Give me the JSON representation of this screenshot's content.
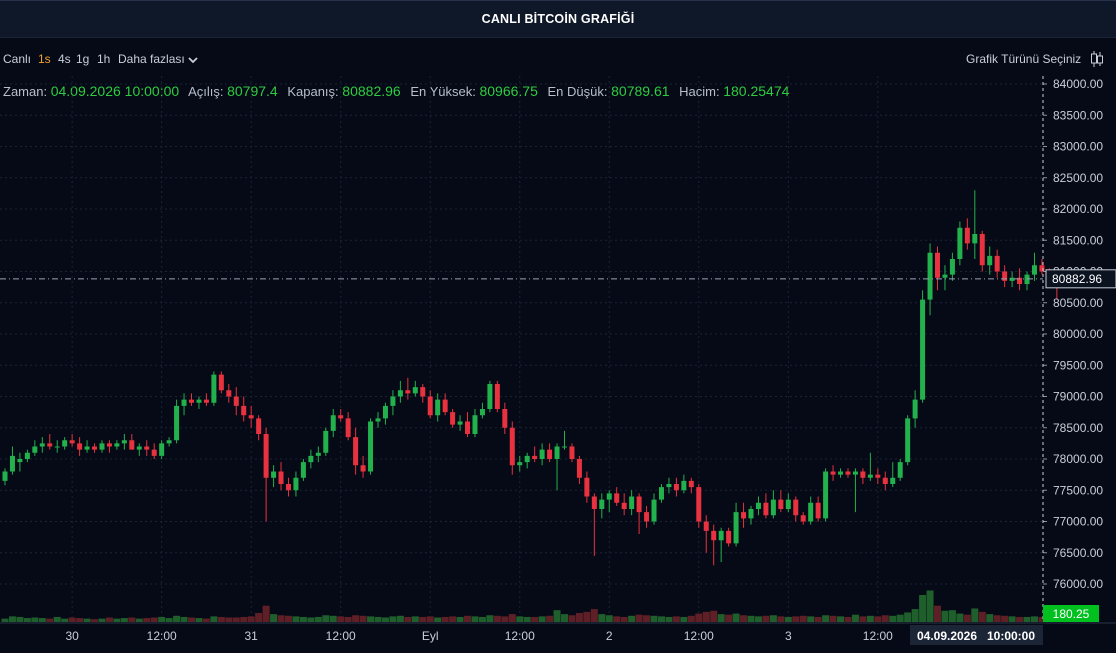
{
  "title": "CANLI BİTCOİN GRAFİĞİ",
  "toolbar": {
    "live": "Canlı",
    "intervals": [
      "1s",
      "4s",
      "1g",
      "1h"
    ],
    "active_interval": "1s",
    "more": "Daha fazlası",
    "chart_type": "Grafik Türünü Seçiniz"
  },
  "ohlc": {
    "time_label": "Zaman:",
    "time": "04.09.2026 10:00:00",
    "open_label": "Açılış:",
    "open": "80797.4",
    "close_label": "Kapanış:",
    "close": "80882.96",
    "high_label": "En Yüksek:",
    "high": "80966.75",
    "low_label": "En Düşük:",
    "low": "80789.61",
    "volume_label": "Hacim:",
    "volume": "180.25474"
  },
  "price_tag": "80882.96",
  "volume_tag": "180.25",
  "crosshair_date": "04.09.2026",
  "crosshair_time": "10:00:00",
  "colors": {
    "up": "#22b14c",
    "down": "#e8323f",
    "background": "#050a16",
    "grid": "#1a2433",
    "volume_tag": "#00c020"
  },
  "chart_data": {
    "type": "candlestick",
    "title": "CANLI BİTCOİN GRAFİĞİ",
    "xlabel": "",
    "ylabel": "",
    "ylim": [
      75850,
      84050
    ],
    "y_ticks": [
      76000,
      76500,
      77000,
      77500,
      78000,
      78500,
      79000,
      79500,
      80000,
      80500,
      81000,
      81500,
      82000,
      82500,
      83000,
      83500,
      84000
    ],
    "y_tick_labels": [
      "76000.00",
      "76500.00",
      "77000.00",
      "77500.00",
      "78000.00",
      "78500.00",
      "79000.00",
      "79500.00",
      "80000.00",
      "80500.00",
      "81000.00",
      "81500.00",
      "82000.00",
      "82500.00",
      "83000.00",
      "83500.00",
      "84000.00"
    ],
    "x_ticks": [
      {
        "label": "30",
        "index": 9
      },
      {
        "label": "12:00",
        "index": 21
      },
      {
        "label": "31",
        "index": 33
      },
      {
        "label": "12:00",
        "index": 45
      },
      {
        "label": "Eyl",
        "index": 57
      },
      {
        "label": "12:00",
        "index": 69
      },
      {
        "label": "2",
        "index": 81
      },
      {
        "label": "12:00",
        "index": 93
      },
      {
        "label": "3",
        "index": 105
      },
      {
        "label": "12:00",
        "index": 117
      }
    ],
    "grid": true,
    "candles": [
      {
        "o": 77650,
        "h": 77850,
        "l": 77580,
        "c": 77800,
        "v": 6
      },
      {
        "o": 77800,
        "h": 78200,
        "l": 77750,
        "c": 78050,
        "v": 10
      },
      {
        "o": 77950,
        "h": 78100,
        "l": 77800,
        "c": 78000,
        "v": 9
      },
      {
        "o": 78000,
        "h": 78150,
        "l": 77950,
        "c": 78100,
        "v": 7
      },
      {
        "o": 78100,
        "h": 78300,
        "l": 78050,
        "c": 78200,
        "v": 8
      },
      {
        "o": 78200,
        "h": 78350,
        "l": 78100,
        "c": 78250,
        "v": 7
      },
      {
        "o": 78250,
        "h": 78400,
        "l": 78150,
        "c": 78200,
        "v": 6
      },
      {
        "o": 78200,
        "h": 78300,
        "l": 78100,
        "c": 78200,
        "v": 9
      },
      {
        "o": 78200,
        "h": 78350,
        "l": 78150,
        "c": 78300,
        "v": 6
      },
      {
        "o": 78300,
        "h": 78400,
        "l": 78200,
        "c": 78250,
        "v": 8
      },
      {
        "o": 78250,
        "h": 78350,
        "l": 78050,
        "c": 78150,
        "v": 7
      },
      {
        "o": 78150,
        "h": 78300,
        "l": 78100,
        "c": 78200,
        "v": 6
      },
      {
        "o": 78200,
        "h": 78250,
        "l": 78100,
        "c": 78150,
        "v": 5
      },
      {
        "o": 78150,
        "h": 78300,
        "l": 78100,
        "c": 78250,
        "v": 6
      },
      {
        "o": 78250,
        "h": 78300,
        "l": 78100,
        "c": 78200,
        "v": 8
      },
      {
        "o": 78200,
        "h": 78300,
        "l": 78150,
        "c": 78250,
        "v": 6
      },
      {
        "o": 78250,
        "h": 78400,
        "l": 78150,
        "c": 78300,
        "v": 7
      },
      {
        "o": 78300,
        "h": 78400,
        "l": 78150,
        "c": 78150,
        "v": 8
      },
      {
        "o": 78150,
        "h": 78250,
        "l": 78050,
        "c": 78200,
        "v": 6
      },
      {
        "o": 78200,
        "h": 78300,
        "l": 78050,
        "c": 78150,
        "v": 7
      },
      {
        "o": 78150,
        "h": 78250,
        "l": 78000,
        "c": 78050,
        "v": 8
      },
      {
        "o": 78050,
        "h": 78300,
        "l": 78000,
        "c": 78250,
        "v": 9
      },
      {
        "o": 78250,
        "h": 78350,
        "l": 78200,
        "c": 78300,
        "v": 7
      },
      {
        "o": 78300,
        "h": 78950,
        "l": 78250,
        "c": 78850,
        "v": 11
      },
      {
        "o": 78850,
        "h": 79050,
        "l": 78700,
        "c": 78950,
        "v": 9
      },
      {
        "o": 78950,
        "h": 79050,
        "l": 78850,
        "c": 78900,
        "v": 8
      },
      {
        "o": 78900,
        "h": 79000,
        "l": 78800,
        "c": 78950,
        "v": 7
      },
      {
        "o": 78950,
        "h": 79050,
        "l": 78850,
        "c": 78900,
        "v": 6
      },
      {
        "o": 78900,
        "h": 79400,
        "l": 78850,
        "c": 79350,
        "v": 10
      },
      {
        "o": 79350,
        "h": 79400,
        "l": 79050,
        "c": 79100,
        "v": 9
      },
      {
        "o": 79100,
        "h": 79200,
        "l": 78900,
        "c": 79000,
        "v": 8
      },
      {
        "o": 79000,
        "h": 79150,
        "l": 78700,
        "c": 78850,
        "v": 8
      },
      {
        "o": 78850,
        "h": 79000,
        "l": 78600,
        "c": 78700,
        "v": 9
      },
      {
        "o": 78700,
        "h": 78850,
        "l": 78500,
        "c": 78650,
        "v": 10
      },
      {
        "o": 78650,
        "h": 78700,
        "l": 78300,
        "c": 78400,
        "v": 16
      },
      {
        "o": 78400,
        "h": 78500,
        "l": 77000,
        "c": 77700,
        "v": 29
      },
      {
        "o": 77700,
        "h": 77900,
        "l": 77550,
        "c": 77800,
        "v": 14
      },
      {
        "o": 77800,
        "h": 77950,
        "l": 77500,
        "c": 77600,
        "v": 12
      },
      {
        "o": 77600,
        "h": 77700,
        "l": 77400,
        "c": 77500,
        "v": 11
      },
      {
        "o": 77500,
        "h": 77800,
        "l": 77400,
        "c": 77700,
        "v": 10
      },
      {
        "o": 77700,
        "h": 78000,
        "l": 77650,
        "c": 77950,
        "v": 9
      },
      {
        "o": 77950,
        "h": 78150,
        "l": 77850,
        "c": 78050,
        "v": 8
      },
      {
        "o": 78050,
        "h": 78200,
        "l": 77950,
        "c": 78100,
        "v": 9
      },
      {
        "o": 78100,
        "h": 78500,
        "l": 78050,
        "c": 78450,
        "v": 12
      },
      {
        "o": 78450,
        "h": 78800,
        "l": 78350,
        "c": 78700,
        "v": 11
      },
      {
        "o": 78700,
        "h": 78800,
        "l": 78600,
        "c": 78650,
        "v": 10
      },
      {
        "o": 78650,
        "h": 78750,
        "l": 78300,
        "c": 78350,
        "v": 9
      },
      {
        "o": 78350,
        "h": 78500,
        "l": 77750,
        "c": 77900,
        "v": 12
      },
      {
        "o": 77900,
        "h": 78050,
        "l": 77700,
        "c": 77800,
        "v": 11
      },
      {
        "o": 77800,
        "h": 78650,
        "l": 77750,
        "c": 78600,
        "v": 10
      },
      {
        "o": 78600,
        "h": 78750,
        "l": 78500,
        "c": 78650,
        "v": 9
      },
      {
        "o": 78650,
        "h": 78900,
        "l": 78550,
        "c": 78850,
        "v": 8
      },
      {
        "o": 78850,
        "h": 79100,
        "l": 78700,
        "c": 79000,
        "v": 10
      },
      {
        "o": 79000,
        "h": 79250,
        "l": 78900,
        "c": 79100,
        "v": 11
      },
      {
        "o": 79100,
        "h": 79300,
        "l": 78950,
        "c": 79050,
        "v": 9
      },
      {
        "o": 79050,
        "h": 79250,
        "l": 79000,
        "c": 79150,
        "v": 10
      },
      {
        "o": 79150,
        "h": 79200,
        "l": 78900,
        "c": 79000,
        "v": 9
      },
      {
        "o": 79000,
        "h": 79100,
        "l": 78650,
        "c": 78700,
        "v": 10
      },
      {
        "o": 78700,
        "h": 79050,
        "l": 78600,
        "c": 78950,
        "v": 8
      },
      {
        "o": 78950,
        "h": 79050,
        "l": 78700,
        "c": 78750,
        "v": 9
      },
      {
        "o": 78750,
        "h": 78800,
        "l": 78500,
        "c": 78550,
        "v": 10
      },
      {
        "o": 78550,
        "h": 78700,
        "l": 78450,
        "c": 78600,
        "v": 9
      },
      {
        "o": 78600,
        "h": 78750,
        "l": 78350,
        "c": 78400,
        "v": 11
      },
      {
        "o": 78400,
        "h": 78800,
        "l": 78350,
        "c": 78700,
        "v": 10
      },
      {
        "o": 78700,
        "h": 78900,
        "l": 78650,
        "c": 78800,
        "v": 9
      },
      {
        "o": 78800,
        "h": 79250,
        "l": 78750,
        "c": 79200,
        "v": 12
      },
      {
        "o": 79200,
        "h": 79250,
        "l": 78750,
        "c": 78800,
        "v": 11
      },
      {
        "o": 78800,
        "h": 78900,
        "l": 78400,
        "c": 78500,
        "v": 10
      },
      {
        "o": 78500,
        "h": 78600,
        "l": 77750,
        "c": 77900,
        "v": 14
      },
      {
        "o": 77900,
        "h": 78050,
        "l": 77800,
        "c": 77950,
        "v": 10
      },
      {
        "o": 77950,
        "h": 78100,
        "l": 77850,
        "c": 78050,
        "v": 9
      },
      {
        "o": 78050,
        "h": 78200,
        "l": 77950,
        "c": 78000,
        "v": 9
      },
      {
        "o": 78000,
        "h": 78250,
        "l": 77900,
        "c": 78150,
        "v": 10
      },
      {
        "o": 78150,
        "h": 78250,
        "l": 77950,
        "c": 78000,
        "v": 11
      },
      {
        "o": 78000,
        "h": 78250,
        "l": 77500,
        "c": 78200,
        "v": 21
      },
      {
        "o": 78200,
        "h": 78450,
        "l": 78150,
        "c": 78200,
        "v": 14
      },
      {
        "o": 78200,
        "h": 78250,
        "l": 77950,
        "c": 78000,
        "v": 12
      },
      {
        "o": 78000,
        "h": 78050,
        "l": 77600,
        "c": 77700,
        "v": 16
      },
      {
        "o": 77700,
        "h": 77800,
        "l": 77300,
        "c": 77400,
        "v": 18
      },
      {
        "o": 77400,
        "h": 77450,
        "l": 76450,
        "c": 77200,
        "v": 23
      },
      {
        "o": 77200,
        "h": 77450,
        "l": 77050,
        "c": 77350,
        "v": 14
      },
      {
        "o": 77350,
        "h": 77500,
        "l": 77150,
        "c": 77450,
        "v": 12
      },
      {
        "o": 77450,
        "h": 77550,
        "l": 77250,
        "c": 77300,
        "v": 10
      },
      {
        "o": 77300,
        "h": 77450,
        "l": 77100,
        "c": 77200,
        "v": 9
      },
      {
        "o": 77200,
        "h": 77500,
        "l": 77100,
        "c": 77400,
        "v": 11
      },
      {
        "o": 77400,
        "h": 77450,
        "l": 76800,
        "c": 77150,
        "v": 13
      },
      {
        "o": 77150,
        "h": 77250,
        "l": 76900,
        "c": 77000,
        "v": 12
      },
      {
        "o": 77000,
        "h": 77450,
        "l": 76950,
        "c": 77350,
        "v": 11
      },
      {
        "o": 77350,
        "h": 77600,
        "l": 77300,
        "c": 77550,
        "v": 10
      },
      {
        "o": 77550,
        "h": 77700,
        "l": 77450,
        "c": 77600,
        "v": 9
      },
      {
        "o": 77600,
        "h": 77700,
        "l": 77400,
        "c": 77500,
        "v": 10
      },
      {
        "o": 77500,
        "h": 77750,
        "l": 77450,
        "c": 77650,
        "v": 9
      },
      {
        "o": 77650,
        "h": 77700,
        "l": 77450,
        "c": 77550,
        "v": 11
      },
      {
        "o": 77550,
        "h": 77600,
        "l": 76900,
        "c": 77000,
        "v": 15
      },
      {
        "o": 77000,
        "h": 77100,
        "l": 76500,
        "c": 76850,
        "v": 18
      },
      {
        "o": 76850,
        "h": 76950,
        "l": 76300,
        "c": 76700,
        "v": 20
      },
      {
        "o": 76700,
        "h": 76900,
        "l": 76350,
        "c": 76850,
        "v": 14
      },
      {
        "o": 76850,
        "h": 76900,
        "l": 76600,
        "c": 76650,
        "v": 13
      },
      {
        "o": 76650,
        "h": 77300,
        "l": 76600,
        "c": 77150,
        "v": 15
      },
      {
        "o": 77150,
        "h": 77300,
        "l": 76900,
        "c": 77050,
        "v": 12
      },
      {
        "o": 77050,
        "h": 77250,
        "l": 76950,
        "c": 77200,
        "v": 11
      },
      {
        "o": 77200,
        "h": 77400,
        "l": 77100,
        "c": 77300,
        "v": 10
      },
      {
        "o": 77300,
        "h": 77450,
        "l": 77050,
        "c": 77100,
        "v": 11
      },
      {
        "o": 77100,
        "h": 77500,
        "l": 77050,
        "c": 77350,
        "v": 12
      },
      {
        "o": 77350,
        "h": 77500,
        "l": 77150,
        "c": 77200,
        "v": 10
      },
      {
        "o": 77200,
        "h": 77450,
        "l": 77150,
        "c": 77350,
        "v": 9
      },
      {
        "o": 77350,
        "h": 77400,
        "l": 77000,
        "c": 77100,
        "v": 10
      },
      {
        "o": 77100,
        "h": 77150,
        "l": 76950,
        "c": 77000,
        "v": 11
      },
      {
        "o": 77000,
        "h": 77400,
        "l": 76950,
        "c": 77300,
        "v": 10
      },
      {
        "o": 77300,
        "h": 77400,
        "l": 77000,
        "c": 77050,
        "v": 9
      },
      {
        "o": 77050,
        "h": 77850,
        "l": 77000,
        "c": 77800,
        "v": 12
      },
      {
        "o": 77800,
        "h": 77900,
        "l": 77650,
        "c": 77750,
        "v": 11
      },
      {
        "o": 77750,
        "h": 77850,
        "l": 77700,
        "c": 77800,
        "v": 10
      },
      {
        "o": 77800,
        "h": 77850,
        "l": 77700,
        "c": 77750,
        "v": 9
      },
      {
        "o": 77750,
        "h": 77850,
        "l": 77150,
        "c": 77800,
        "v": 13
      },
      {
        "o": 77800,
        "h": 77850,
        "l": 77600,
        "c": 77700,
        "v": 10
      },
      {
        "o": 77700,
        "h": 78100,
        "l": 77650,
        "c": 77750,
        "v": 11
      },
      {
        "o": 77750,
        "h": 77850,
        "l": 77600,
        "c": 77700,
        "v": 10
      },
      {
        "o": 77700,
        "h": 77800,
        "l": 77500,
        "c": 77600,
        "v": 12
      },
      {
        "o": 77600,
        "h": 77950,
        "l": 77550,
        "c": 77700,
        "v": 11
      },
      {
        "o": 77700,
        "h": 78000,
        "l": 77650,
        "c": 77950,
        "v": 13
      },
      {
        "o": 77950,
        "h": 78700,
        "l": 77900,
        "c": 78650,
        "v": 17
      },
      {
        "o": 78650,
        "h": 79100,
        "l": 78500,
        "c": 78950,
        "v": 23
      },
      {
        "o": 78950,
        "h": 80700,
        "l": 78900,
        "c": 80550,
        "v": 48
      },
      {
        "o": 80550,
        "h": 81450,
        "l": 80300,
        "c": 81300,
        "v": 56
      },
      {
        "o": 81300,
        "h": 81400,
        "l": 80700,
        "c": 80900,
        "v": 29
      },
      {
        "o": 80900,
        "h": 81100,
        "l": 80700,
        "c": 80950,
        "v": 20
      },
      {
        "o": 80950,
        "h": 81300,
        "l": 80850,
        "c": 81200,
        "v": 21
      },
      {
        "o": 81200,
        "h": 81800,
        "l": 81100,
        "c": 81700,
        "v": 15
      },
      {
        "o": 81700,
        "h": 81850,
        "l": 81350,
        "c": 81450,
        "v": 13
      },
      {
        "o": 81450,
        "h": 82300,
        "l": 81200,
        "c": 81600,
        "v": 24
      },
      {
        "o": 81600,
        "h": 81650,
        "l": 81000,
        "c": 81100,
        "v": 18
      },
      {
        "o": 81100,
        "h": 81400,
        "l": 80950,
        "c": 81250,
        "v": 14
      },
      {
        "o": 81250,
        "h": 81350,
        "l": 80900,
        "c": 81000,
        "v": 12
      },
      {
        "o": 81000,
        "h": 81100,
        "l": 80750,
        "c": 80850,
        "v": 11
      },
      {
        "o": 80850,
        "h": 81000,
        "l": 80750,
        "c": 80900,
        "v": 10
      },
      {
        "o": 80900,
        "h": 81050,
        "l": 80700,
        "c": 80800,
        "v": 9
      },
      {
        "o": 80800,
        "h": 81000,
        "l": 80700,
        "c": 80950,
        "v": 9
      },
      {
        "o": 80950,
        "h": 81300,
        "l": 80850,
        "c": 81100,
        "v": 10
      },
      {
        "o": 81100,
        "h": 81200,
        "l": 80950,
        "c": 81000,
        "v": 9
      },
      {
        "o": 81000,
        "h": 81050,
        "l": 80850,
        "c": 80950,
        "v": 8
      },
      {
        "o": 80950,
        "h": 81000,
        "l": 80550,
        "c": 80800,
        "v": 10
      },
      {
        "o": 80797.4,
        "h": 80966.75,
        "l": 80789.61,
        "c": 80882.96,
        "v": 7
      }
    ]
  }
}
